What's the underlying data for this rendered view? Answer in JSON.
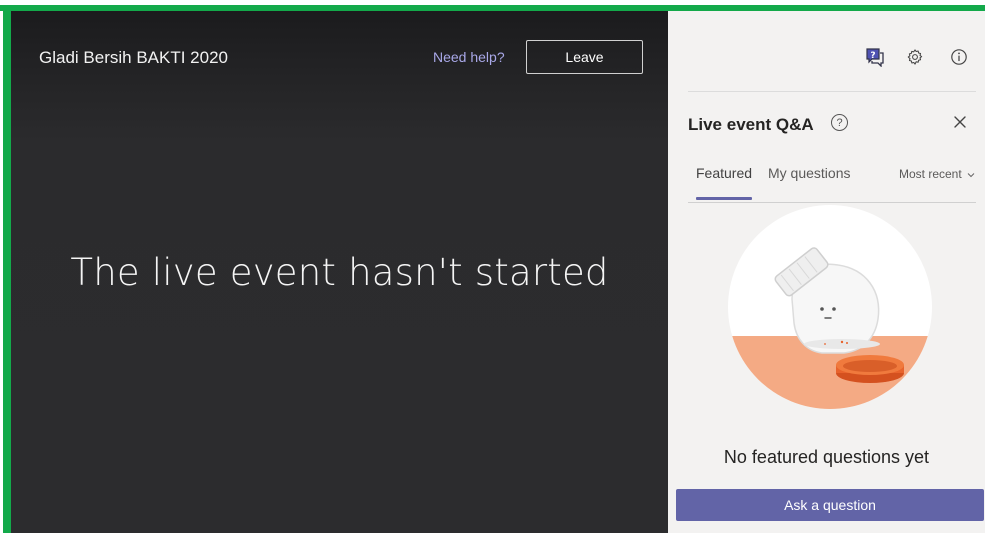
{
  "stage": {
    "event_title": "Gladi Bersih BAKTI 2020",
    "help_link": "Need help?",
    "leave_label": "Leave",
    "status_message": "The live event hasn't started"
  },
  "panel": {
    "toolbar_icons": [
      "question-chat-icon",
      "gear-icon",
      "info-icon"
    ],
    "title": "Live event Q&A",
    "help_glyph": "?",
    "tabs": [
      {
        "label": "Featured",
        "selected": true
      },
      {
        "label": "My questions",
        "selected": false
      }
    ],
    "sort_label": "Most recent",
    "empty_message": "No featured questions yet",
    "ask_label": "Ask a question"
  },
  "colors": {
    "frame": "#13a94a",
    "stage_bg": "#2c2c2e",
    "panel_bg": "#f3f2f1",
    "accent": "#6264a7",
    "link": "#a9a8e8",
    "illustration_orange": "#f4aa84",
    "lid": "#e8632c"
  }
}
